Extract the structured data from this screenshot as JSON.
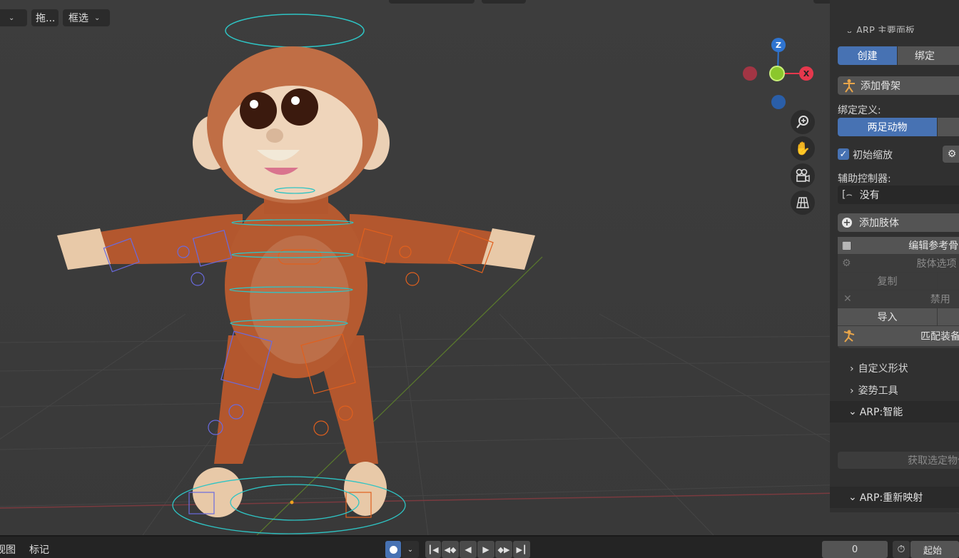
{
  "header": {
    "drag_label": "拖...",
    "select_mode": "框选"
  },
  "gizmo": {
    "z_label": "Z",
    "x_label": "X",
    "colors": {
      "x": "#e6384d",
      "y": "#8bc72c",
      "z": "#2f74d0",
      "neg": "#a23544"
    }
  },
  "nav_icons": [
    "zoom-icon",
    "pan-hand-icon",
    "camera-icon",
    "ortho-grid-icon"
  ],
  "panel": {
    "top_header": "ARP 主要面板",
    "tabs": [
      "创建",
      "绑定"
    ],
    "add_armature": "添加骨架",
    "rig_definition_label": "绑定定义:",
    "rig_type": "两足动物",
    "init_scale": "初始缩放",
    "init_scale_checked": true,
    "helper_ctrl_label": "辅助控制器:",
    "helper_ctrl_value": "没有",
    "add_limb": "添加肢体",
    "edit_ref": "编辑参考骨骼",
    "limb_options": "肢体选项",
    "duplicate": "复制",
    "disable": "禁用",
    "import": "导入",
    "match_rig": "匹配装备",
    "custom_shapes": "自定义形状",
    "pose_tools": "姿势工具",
    "smart_section": "ARP:智能",
    "get_selected": "获取选定物体",
    "remap_section": "ARP:重新映射",
    "accent": "#4772b3"
  },
  "timeline": {
    "view": "视图",
    "marker": "标记",
    "frame": "0",
    "start_label": "起始"
  }
}
